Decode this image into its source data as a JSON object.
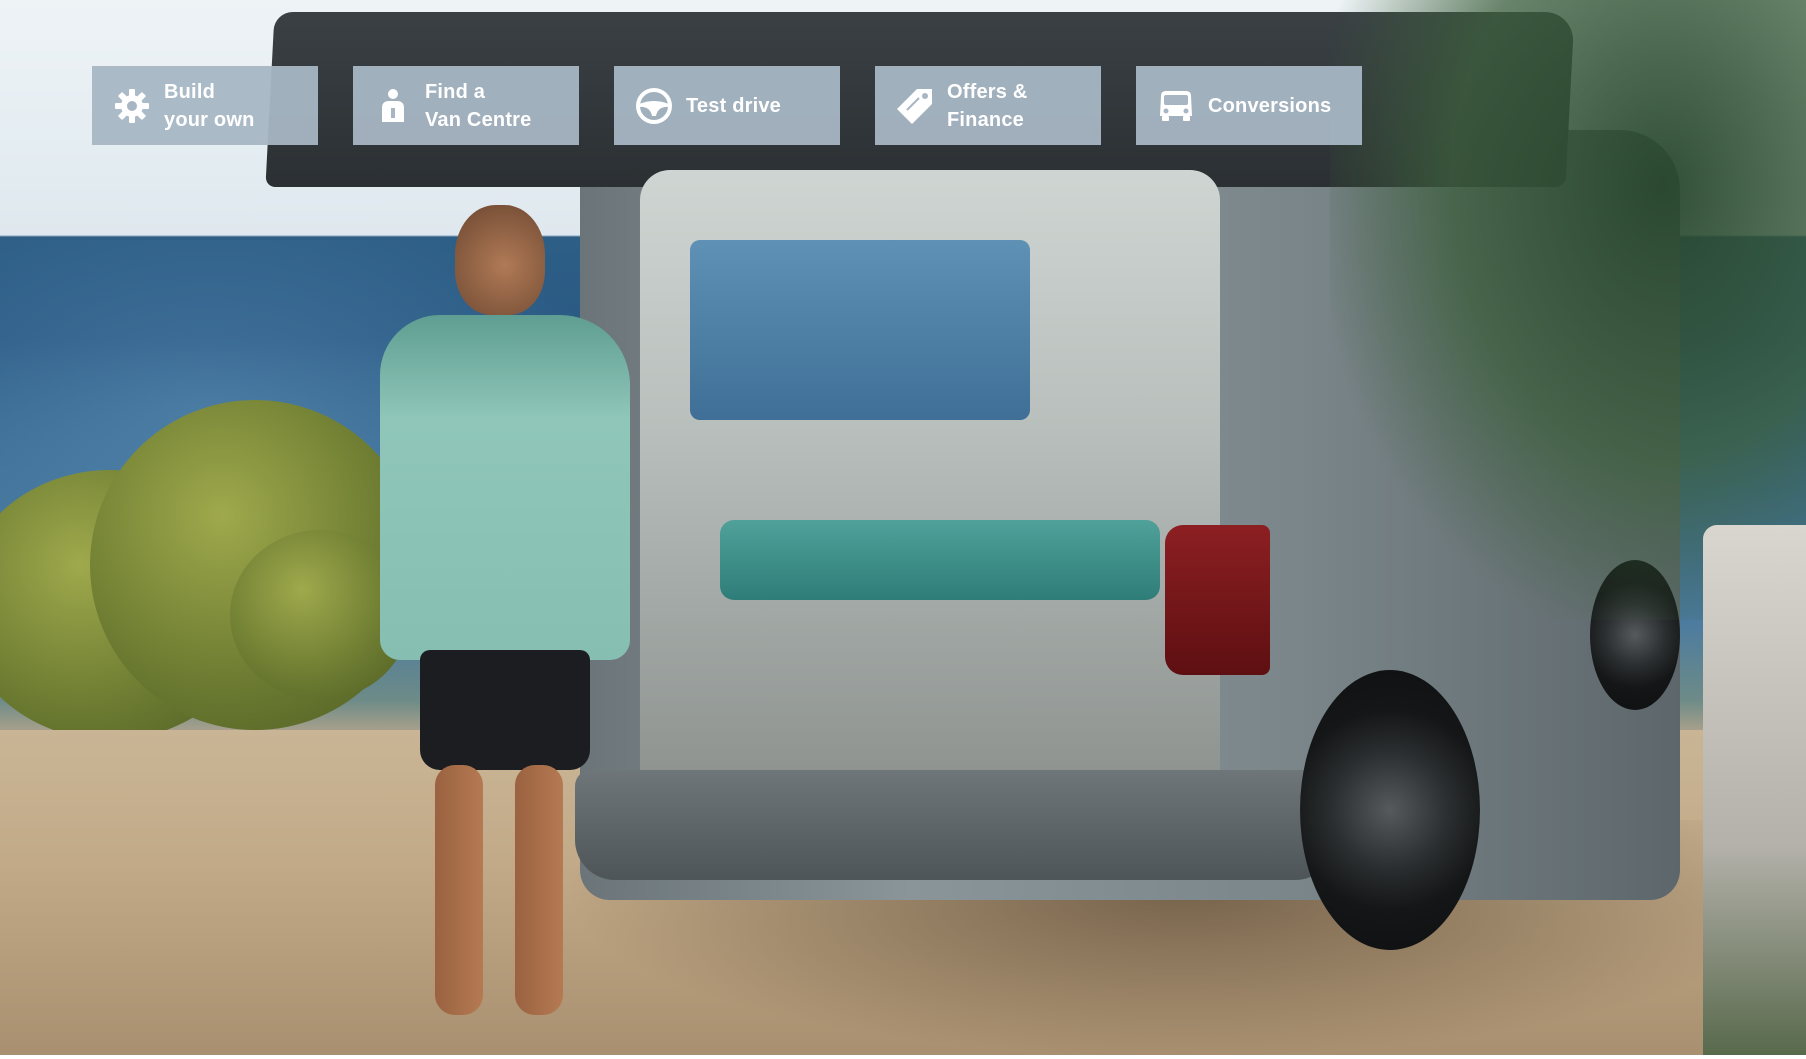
{
  "nav": {
    "items": [
      {
        "label": "Build\nyour own",
        "icon": "gear-icon"
      },
      {
        "label": "Find a\nVan Centre",
        "icon": "person-info-icon"
      },
      {
        "label": "Test drive",
        "icon": "steering-wheel-icon"
      },
      {
        "label": "Offers &\nFinance",
        "icon": "price-tag-icon"
      },
      {
        "label": "Conversions",
        "icon": "van-icon"
      }
    ]
  },
  "theme": {
    "tile_background": "#a8b6c4",
    "tile_text": "#ffffff"
  }
}
